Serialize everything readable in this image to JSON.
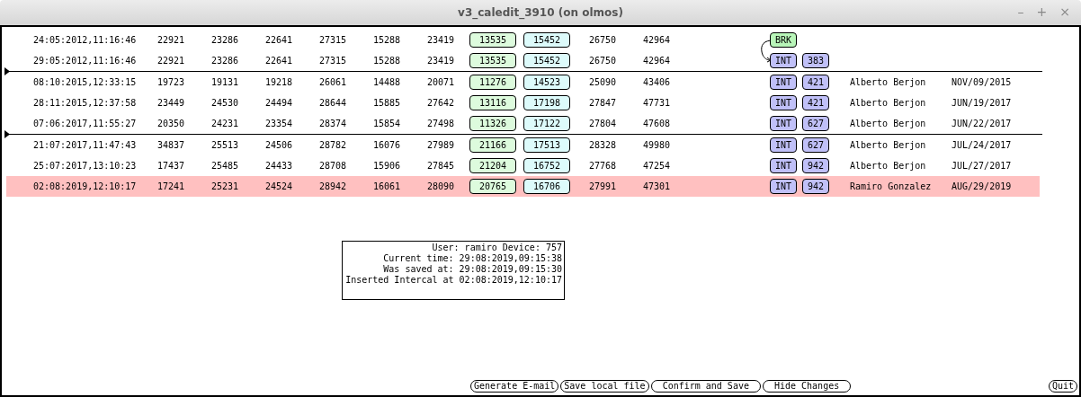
{
  "window": {
    "title": "v3_caledit_3910 (on olmos)",
    "controls": [
      "–",
      "+",
      "×"
    ]
  },
  "rows": [
    {
      "date": "24:05:2012,11:16:46",
      "values": [
        "22921",
        "23286",
        "22641",
        "27315",
        "15288",
        "23419"
      ],
      "green": "13535",
      "cyan": "15452",
      "values2": [
        "26750",
        "42964"
      ],
      "kind": "break",
      "tag": "BRK",
      "separator_before": false,
      "highlighted": false,
      "linked_to_next": true
    },
    {
      "date": "29:05:2012,11:16:46",
      "values": [
        "22921",
        "23286",
        "22641",
        "27315",
        "15288",
        "23419"
      ],
      "green": "13535",
      "cyan": "15452",
      "values2": [
        "26750",
        "42964"
      ],
      "kind": "intercal",
      "tag": "INT",
      "badge": "383",
      "separator_before": false,
      "highlighted": false,
      "linked_to_next": false
    },
    {
      "date": "08:10:2015,12:33:15",
      "values": [
        "19723",
        "19131",
        "19218",
        "26061",
        "14488",
        "20071"
      ],
      "green": "11276",
      "cyan": "14523",
      "values2": [
        "25090",
        "43406"
      ],
      "kind": "intercal",
      "tag": "INT",
      "badge": "421",
      "user": "Alberto Berjon",
      "user_date": "NOV/09/2015",
      "separator_before": true,
      "highlighted": false,
      "linked_to_next": false
    },
    {
      "date": "28:11:2015,12:37:58",
      "values": [
        "23449",
        "24530",
        "24494",
        "28644",
        "15885",
        "27642"
      ],
      "green": "13116",
      "cyan": "17198",
      "values2": [
        "27847",
        "47731"
      ],
      "kind": "intercal",
      "tag": "INT",
      "badge": "421",
      "user": "Alberto Berjon",
      "user_date": "JUN/19/2017",
      "separator_before": false,
      "highlighted": false,
      "linked_to_next": false
    },
    {
      "date": "07:06:2017,11:55:27",
      "values": [
        "20350",
        "24231",
        "23354",
        "28374",
        "15854",
        "27498"
      ],
      "green": "11326",
      "cyan": "17122",
      "values2": [
        "27804",
        "47608"
      ],
      "kind": "intercal",
      "tag": "INT",
      "badge": "627",
      "user": "Alberto Berjon",
      "user_date": "JUN/22/2017",
      "separator_before": false,
      "highlighted": false,
      "linked_to_next": false
    },
    {
      "date": "21:07:2017,11:47:43",
      "values": [
        "34837",
        "25513",
        "24506",
        "28782",
        "16076",
        "27989"
      ],
      "green": "21166",
      "cyan": "17513",
      "values2": [
        "28328",
        "49980"
      ],
      "kind": "intercal",
      "tag": "INT",
      "badge": "627",
      "user": "Alberto Berjon",
      "user_date": "JUL/24/2017",
      "separator_before": true,
      "highlighted": false,
      "linked_to_next": false
    },
    {
      "date": "25:07:2017,13:10:23",
      "values": [
        "17437",
        "25485",
        "24433",
        "28708",
        "15906",
        "27845"
      ],
      "green": "21204",
      "cyan": "16752",
      "values2": [
        "27768",
        "47254"
      ],
      "kind": "intercal",
      "tag": "INT",
      "badge": "942",
      "user": "Alberto Berjon",
      "user_date": "JUL/27/2017",
      "separator_before": false,
      "highlighted": false,
      "linked_to_next": false
    },
    {
      "date": "02:08:2019,12:10:17",
      "values": [
        "17241",
        "25231",
        "24524",
        "28942",
        "16061",
        "28090"
      ],
      "green": "20765",
      "cyan": "16706",
      "values2": [
        "27991",
        "47301"
      ],
      "kind": "intercal",
      "tag": "INT",
      "badge": "942",
      "user": "Ramiro Gonzalez",
      "user_date": "AUG/29/2019",
      "separator_before": false,
      "highlighted": true,
      "linked_to_next": false
    }
  ],
  "info": [
    "User: ramiro Device: 757",
    "Current time: 29:08:2019,09:15:38",
    "Was saved at: 29:08:2019,09:15:30",
    "Inserted Intercal at 02:08:2019,12:10:17"
  ],
  "buttons": [
    "Generate E-mail",
    "Save local file",
    "Confirm and Save",
    "Hide Changes"
  ],
  "quit_button": "Quit"
}
